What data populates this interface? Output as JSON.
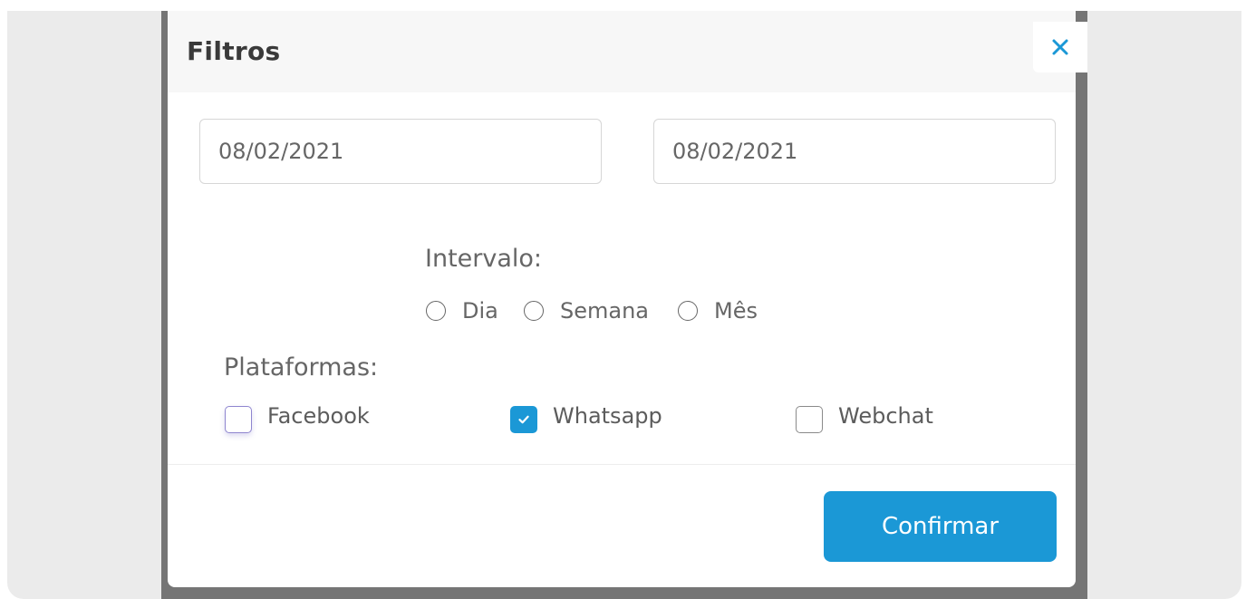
{
  "modal": {
    "title": "Filtros",
    "close_icon": "close-icon"
  },
  "date_range": {
    "start_value": "08/02/2021",
    "end_value": "08/02/2021"
  },
  "interval": {
    "label": "Intervalo:",
    "options": [
      {
        "label": "Dia",
        "selected": false
      },
      {
        "label": "Semana",
        "selected": false
      },
      {
        "label": "Mês",
        "selected": false
      }
    ]
  },
  "platforms": {
    "label": "Plataformas:",
    "options": [
      {
        "label": "Facebook",
        "checked": false
      },
      {
        "label": "Whatsapp",
        "checked": true
      },
      {
        "label": "Webchat",
        "checked": false
      }
    ]
  },
  "footer": {
    "confirm_label": "Confirmar"
  },
  "colors": {
    "accent": "#1b98d6",
    "close_icon": "#1b98d6",
    "text_muted": "#666666",
    "title": "#3a3a3a"
  }
}
